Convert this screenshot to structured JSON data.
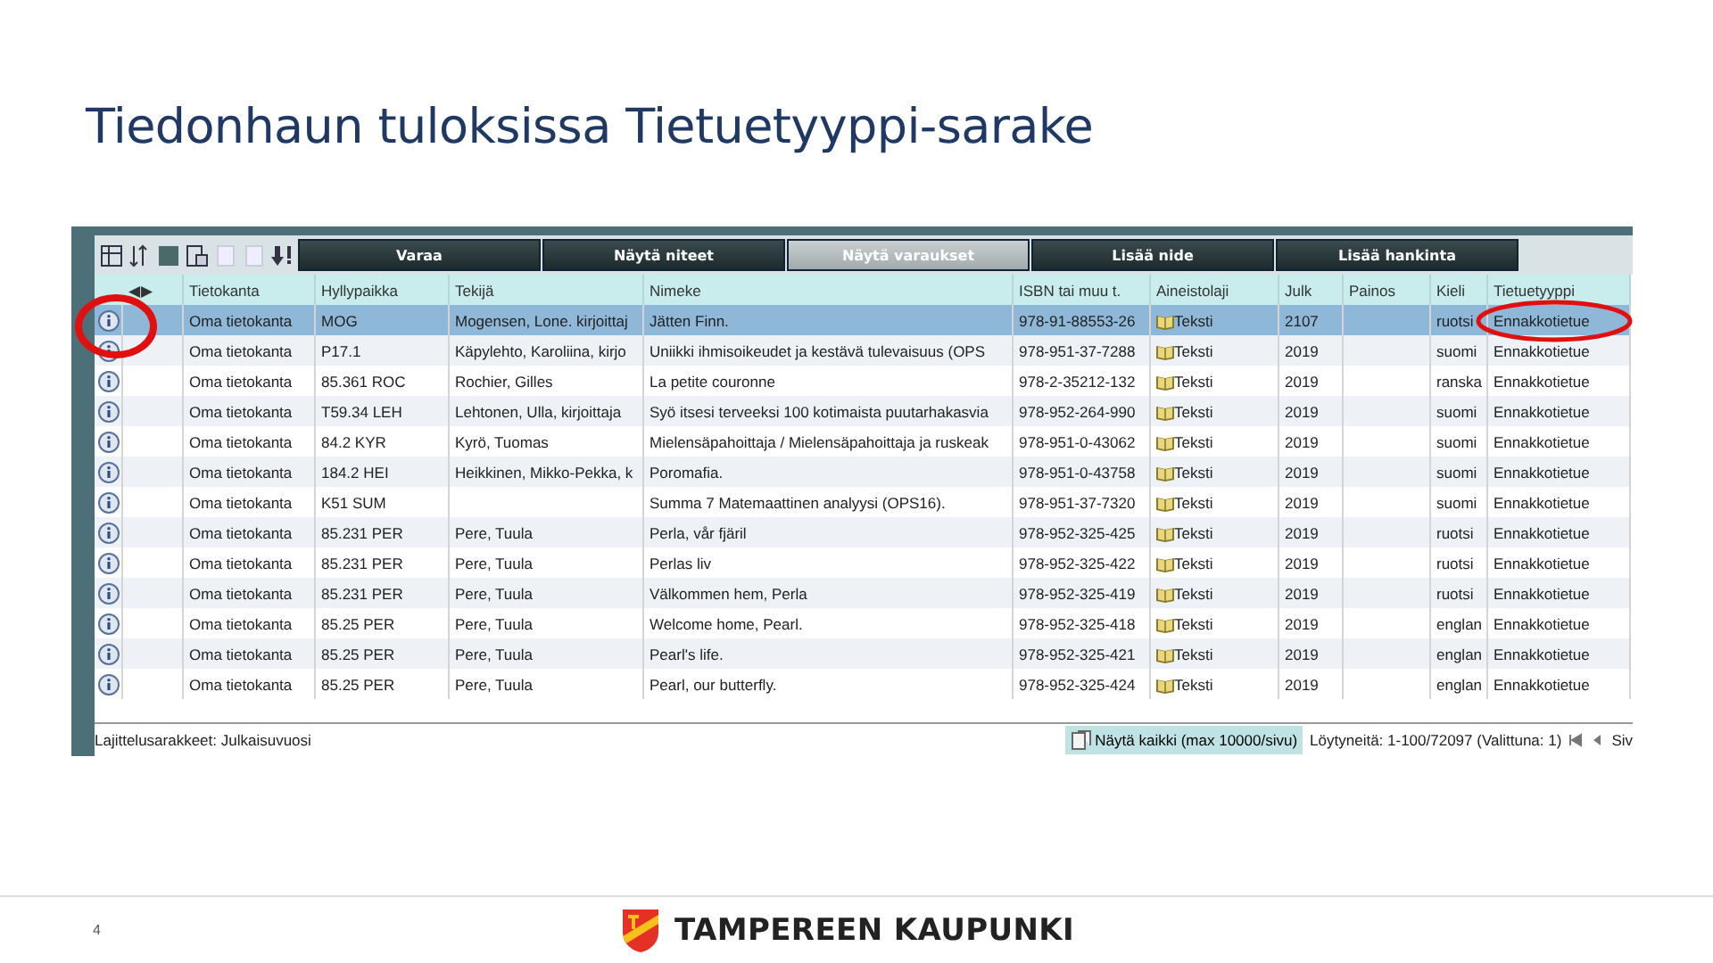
{
  "slide_title": "Tiedonhaun tuloksissa Tietuetyyppi-sarake",
  "toolbar": {
    "buttons": [
      {
        "label": "Varaa",
        "selected": false
      },
      {
        "label": "Näytä niteet",
        "selected": false
      },
      {
        "label": "Näytä varaukset",
        "selected": true
      },
      {
        "label": "Lisää nide",
        "selected": false
      },
      {
        "label": "Lisää hankinta",
        "selected": false
      }
    ]
  },
  "table": {
    "nav": "◀▶",
    "columns": [
      "Tietokanta",
      "Hyllypaikka",
      "Tekijä",
      "Nimeke",
      "ISBN tai muu t.",
      "Aineistolaji",
      "Julk",
      "Painos",
      "Kieli",
      "Tietuetyyppi"
    ],
    "rows": [
      {
        "selected": true,
        "cells": [
          "Oma tietokanta",
          "MOG",
          "Mogensen, Lone. kirjoittaj",
          "Jätten Finn.",
          "978-91-88553-26",
          "Teksti",
          "2107",
          "",
          "ruotsi",
          "Ennakkotietue"
        ]
      },
      {
        "selected": false,
        "cells": [
          "Oma tietokanta",
          "P17.1",
          "Käpylehto, Karoliina, kirjo",
          "Uniikki ihmisoikeudet ja kestävä tulevaisuus (OPS",
          "978-951-37-7288",
          "Teksti",
          "2019",
          "",
          "suomi",
          "Ennakkotietue"
        ]
      },
      {
        "selected": false,
        "cells": [
          "Oma tietokanta",
          "85.361 ROC",
          "Rochier, Gilles",
          "La petite couronne",
          "978-2-35212-132",
          "Teksti",
          "2019",
          "",
          "ranska",
          "Ennakkotietue"
        ]
      },
      {
        "selected": false,
        "cells": [
          "Oma tietokanta",
          "T59.34 LEH",
          "Lehtonen, Ulla, kirjoittaja",
          "Syö itsesi terveeksi 100 kotimaista puutarhakasvia",
          "978-952-264-990",
          "Teksti",
          "2019",
          "",
          "suomi",
          "Ennakkotietue"
        ]
      },
      {
        "selected": false,
        "cells": [
          "Oma tietokanta",
          "84.2 KYR",
          "Kyrö, Tuomas",
          "Mielensäpahoittaja / Mielensäpahoittaja ja ruskeak",
          "978-951-0-43062",
          "Teksti",
          "2019",
          "",
          "suomi",
          "Ennakkotietue"
        ]
      },
      {
        "selected": false,
        "cells": [
          "Oma tietokanta",
          "184.2 HEI",
          "Heikkinen, Mikko-Pekka, k",
          "Poromafia.",
          "978-951-0-43758",
          "Teksti",
          "2019",
          "",
          "suomi",
          "Ennakkotietue"
        ]
      },
      {
        "selected": false,
        "cells": [
          "Oma tietokanta",
          "K51 SUM",
          "",
          "Summa 7 Matemaattinen analyysi (OPS16).",
          "978-951-37-7320",
          "Teksti",
          "2019",
          "",
          "suomi",
          "Ennakkotietue"
        ]
      },
      {
        "selected": false,
        "cells": [
          "Oma tietokanta",
          "85.231 PER",
          "Pere, Tuula",
          "Perla, vår fjäril",
          "978-952-325-425",
          "Teksti",
          "2019",
          "",
          "ruotsi",
          "Ennakkotietue"
        ]
      },
      {
        "selected": false,
        "cells": [
          "Oma tietokanta",
          "85.231 PER",
          "Pere, Tuula",
          "Perlas liv",
          "978-952-325-422",
          "Teksti",
          "2019",
          "",
          "ruotsi",
          "Ennakkotietue"
        ]
      },
      {
        "selected": false,
        "cells": [
          "Oma tietokanta",
          "85.231 PER",
          "Pere, Tuula",
          "Välkommen hem, Perla",
          "978-952-325-419",
          "Teksti",
          "2019",
          "",
          "ruotsi",
          "Ennakkotietue"
        ]
      },
      {
        "selected": false,
        "cells": [
          "Oma tietokanta",
          "85.25 PER",
          "Pere, Tuula",
          "Welcome home, Pearl.",
          "978-952-325-418",
          "Teksti",
          "2019",
          "",
          "englan",
          "Ennakkotietue"
        ]
      },
      {
        "selected": false,
        "cells": [
          "Oma tietokanta",
          "85.25 PER",
          "Pere, Tuula",
          "Pearl's life.",
          "978-952-325-421",
          "Teksti",
          "2019",
          "",
          "englan",
          "Ennakkotietue"
        ]
      },
      {
        "selected": false,
        "cells": [
          "Oma tietokanta",
          "85.25 PER",
          "Pere, Tuula",
          "Pearl, our butterfly.",
          "978-952-325-424",
          "Teksti",
          "2019",
          "",
          "englan",
          "Ennakkotietue"
        ]
      }
    ]
  },
  "status_bar": {
    "sort": "Lajittelusarakkeet: Julkaisuvuosi",
    "show_all": "Näytä kaikki (max 10000/sivu)",
    "found": "Löytyneitä: 1-100/72097 (Valittuna: 1)",
    "page": "Siv"
  },
  "footer": {
    "page_number": "4",
    "logo_text": "TAMPEREEN KAUPUNKI"
  }
}
